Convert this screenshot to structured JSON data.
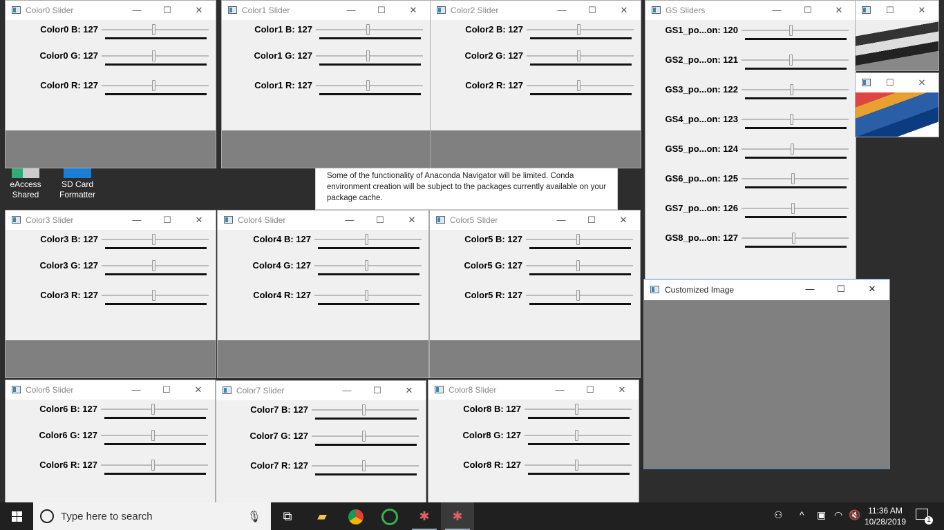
{
  "desktop": {
    "icons": [
      {
        "label": "eAccess\nShared"
      },
      {
        "label": "SD Card\nFormatter"
      }
    ],
    "notice": "Some of the functionality of Anaconda Navigator will be limited. Conda environment creation will be subject to the packages currently available on your package cache."
  },
  "window_controls": {
    "minimize": "—",
    "maximize": "☐",
    "close": "✕"
  },
  "color_windows": [
    {
      "title": "Color0 Slider",
      "sliders": [
        {
          "label": "Color0 B: 127",
          "value": 127
        },
        {
          "label": "Color0 G: 127",
          "value": 127
        },
        {
          "label": "Color0 R: 127",
          "value": 127
        }
      ]
    },
    {
      "title": "Color1 Slider",
      "sliders": [
        {
          "label": "Color1 B: 127",
          "value": 127
        },
        {
          "label": "Color1 G: 127",
          "value": 127
        },
        {
          "label": "Color1 R: 127",
          "value": 127
        }
      ]
    },
    {
      "title": "Color2 Slider",
      "sliders": [
        {
          "label": "Color2 B: 127",
          "value": 127
        },
        {
          "label": "Color2 G: 127",
          "value": 127
        },
        {
          "label": "Color2 R: 127",
          "value": 127
        }
      ]
    },
    {
      "title": "Color3 Slider",
      "sliders": [
        {
          "label": "Color3 B: 127",
          "value": 127
        },
        {
          "label": "Color3 G: 127",
          "value": 127
        },
        {
          "label": "Color3 R: 127",
          "value": 127
        }
      ]
    },
    {
      "title": "Color4 Slider",
      "sliders": [
        {
          "label": "Color4 B: 127",
          "value": 127
        },
        {
          "label": "Color4 G: 127",
          "value": 127
        },
        {
          "label": "Color4 R: 127",
          "value": 127
        }
      ]
    },
    {
      "title": "Color5 Slider",
      "sliders": [
        {
          "label": "Color5 B: 127",
          "value": 127
        },
        {
          "label": "Color5 G: 127",
          "value": 127
        },
        {
          "label": "Color5 R: 127",
          "value": 127
        }
      ]
    },
    {
      "title": "Color6 Slider",
      "sliders": [
        {
          "label": "Color6 B: 127",
          "value": 127
        },
        {
          "label": "Color6 G: 127",
          "value": 127
        },
        {
          "label": "Color6 R: 127",
          "value": 127
        }
      ]
    },
    {
      "title": "Color7 Slider",
      "sliders": [
        {
          "label": "Color7 B: 127",
          "value": 127
        },
        {
          "label": "Color7 G: 127",
          "value": 127
        },
        {
          "label": "Color7 R: 127",
          "value": 127
        }
      ]
    },
    {
      "title": "Color8 Slider",
      "sliders": [
        {
          "label": "Color8 B: 127",
          "value": 127
        },
        {
          "label": "Color8 G: 127",
          "value": 127
        },
        {
          "label": "Color8 R: 127",
          "value": 127
        }
      ]
    }
  ],
  "gs_window": {
    "title": "GS Sliders",
    "sliders": [
      {
        "label": "GS1_po...on: 120",
        "value": 120
      },
      {
        "label": "GS2_po...on: 121",
        "value": 121
      },
      {
        "label": "GS3_po...on: 122",
        "value": 122
      },
      {
        "label": "GS4_po...on: 123",
        "value": 123
      },
      {
        "label": "GS5_po...on: 124",
        "value": 124
      },
      {
        "label": "GS6_po...on: 125",
        "value": 125
      },
      {
        "label": "GS7_po...on: 126",
        "value": 126
      },
      {
        "label": "GS8_po...on: 127",
        "value": 127
      }
    ]
  },
  "slider_max": 255,
  "custom_window": {
    "title": "Customized Image",
    "fill_color": "#808080"
  },
  "colors": {
    "panel_gray": "#808080",
    "window_bg": "#f0f0f0",
    "taskbar": "#202020",
    "accent": "#3c8aa8"
  },
  "taskbar": {
    "search_placeholder": "Type here to search",
    "apps": [
      "task-view-icon",
      "file-explorer-icon",
      "chrome-icon",
      "circle-app-icon",
      "opencv-app-icon",
      "opencv-app-icon-active"
    ],
    "time": "11:36 AM",
    "date": "10/28/2019",
    "notifications": "1"
  }
}
